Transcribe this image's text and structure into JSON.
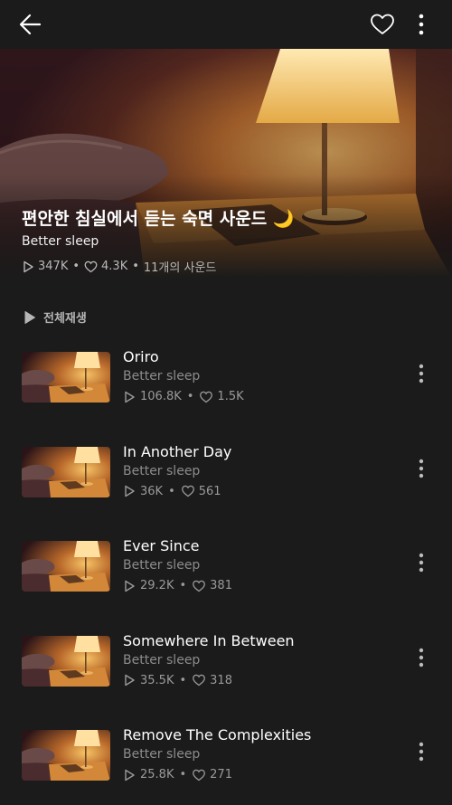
{
  "header": {
    "back_icon": "arrow-left-icon",
    "like_icon": "heart-outline-icon",
    "menu_icon": "kebab-menu-icon"
  },
  "playlist": {
    "title": "편안한 침실에서 듣는 숙면 사운드",
    "title_emoji": "🌙",
    "artist": "Better sleep",
    "plays": "347K",
    "likes": "4.3K",
    "count": "11개의 사운드"
  },
  "play_all": {
    "label": "전체재생",
    "icon": "play-icon"
  },
  "tracks": [
    {
      "title": "Oriro",
      "artist": "Better sleep",
      "plays": "106.8K",
      "likes": "1.5K"
    },
    {
      "title": "In Another Day",
      "artist": "Better sleep",
      "plays": "36K",
      "likes": "561"
    },
    {
      "title": "Ever Since",
      "artist": "Better sleep",
      "plays": "29.2K",
      "likes": "381"
    },
    {
      "title": "Somewhere In Between",
      "artist": "Better sleep",
      "plays": "35.5K",
      "likes": "318"
    },
    {
      "title": "Remove The Complexities",
      "artist": "Better sleep",
      "plays": "25.8K",
      "likes": "271"
    }
  ],
  "colors": {
    "background": "#1b1b1b",
    "text_primary": "#ffffff",
    "text_secondary": "#8c8c8c",
    "lamp_glow": "#f2b44a"
  }
}
